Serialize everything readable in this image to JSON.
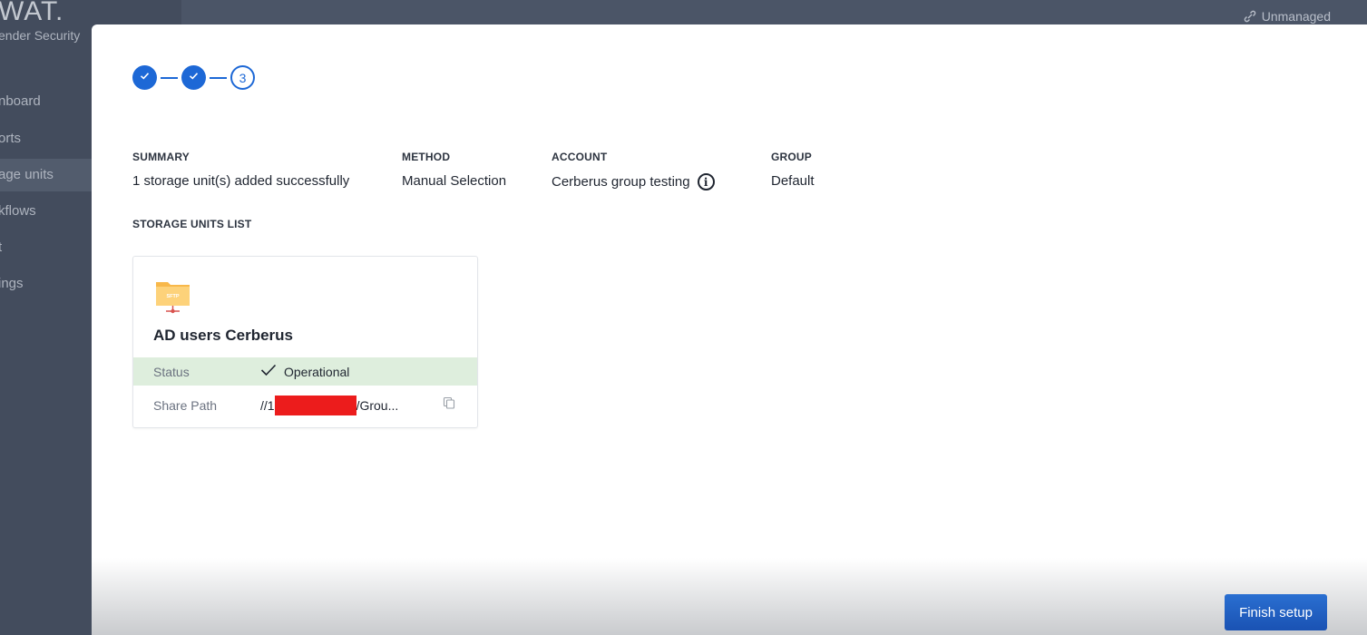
{
  "app": {
    "brand": "WAT.",
    "brand_sub": "ender Security",
    "nav": [
      "nboard",
      "orts",
      "age units",
      "kflows",
      "t",
      "ings"
    ],
    "active_index": 2,
    "top_right": "Unmanaged"
  },
  "stepper": {
    "current_step": "3"
  },
  "summary": {
    "label": "SUMMARY",
    "value": "1 storage unit(s) added successfully"
  },
  "method": {
    "label": "METHOD",
    "value": "Manual Selection"
  },
  "account": {
    "label": "ACCOUNT",
    "value": "Cerberus group testing"
  },
  "group": {
    "label": "GROUP",
    "value": "Default"
  },
  "storage_list": {
    "label": "STORAGE UNITS LIST",
    "card": {
      "icon_text": "SFTP",
      "title": "AD users Cerberus",
      "status_label": "Status",
      "status_value": "Operational",
      "path_label": "Share Path",
      "path_prefix": "//1",
      "path_suffix": "/Grou..."
    }
  },
  "footer": {
    "finish_label": "Finish setup"
  },
  "colors": {
    "primary": "#1d68d6",
    "status_bg": "#deeedd",
    "redaction": "#ec1c1c"
  }
}
